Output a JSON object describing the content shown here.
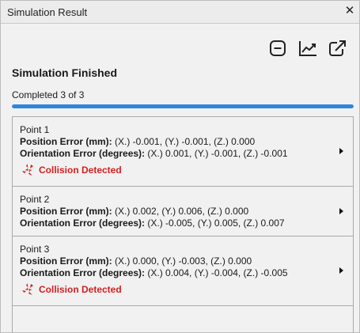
{
  "window": {
    "title": "Simulation Result"
  },
  "toolbar": {
    "icons": [
      "collapse-icon",
      "chart-icon",
      "open-external-icon"
    ]
  },
  "status": {
    "heading": "Simulation Finished",
    "progress_text": "Completed 3 of 3",
    "progress_fraction": 1.0,
    "progress_color": "#2e86de"
  },
  "labels": {
    "position": "Position Error (mm):",
    "orientation": "Orientation Error (degrees):",
    "collision": "Collision Detected"
  },
  "colors": {
    "collision": "#d41f1f"
  },
  "points": [
    {
      "name": "Point 1",
      "position_values": " (X.) -0.001, (Y.) -0.001, (Z.) 0.000",
      "orientation_values": " (X.) 0.001, (Y.) -0.001, (Z.) -0.001",
      "collision": true
    },
    {
      "name": "Point 2",
      "position_values": " (X.) 0.002, (Y.) 0.006, (Z.) 0.000",
      "orientation_values": " (X.) -0.005, (Y.) 0.005, (Z.) 0.007",
      "collision": false
    },
    {
      "name": "Point 3",
      "position_values": " (X.) 0.000, (Y.) -0.003, (Z.) 0.000",
      "orientation_values": " (X.) 0.004, (Y.) -0.004, (Z.) -0.005",
      "collision": true
    }
  ]
}
